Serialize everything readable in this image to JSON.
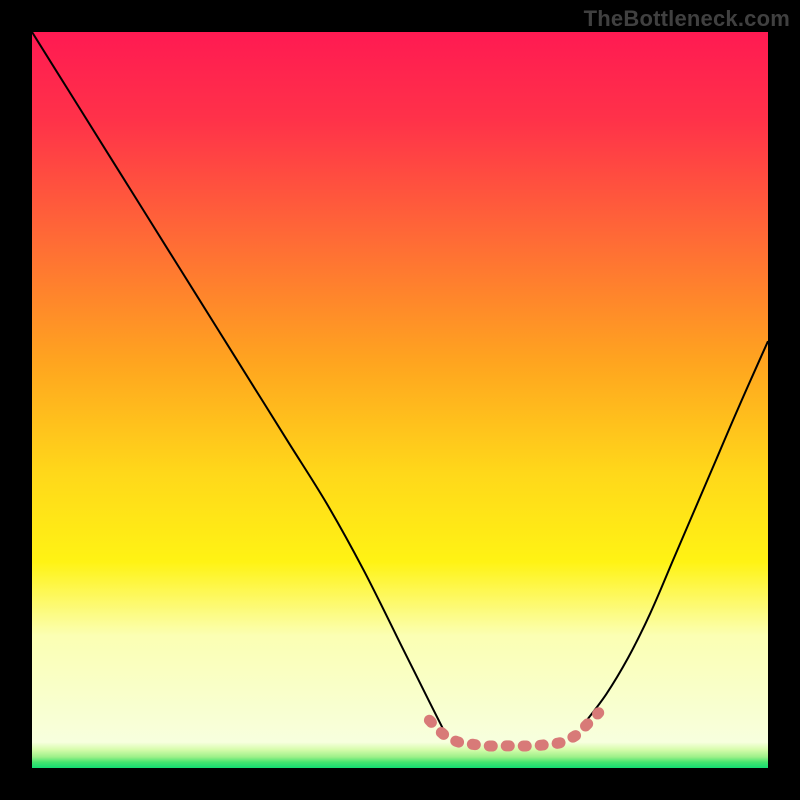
{
  "watermark": "TheBottleneck.com",
  "colors": {
    "frame": "#000000",
    "curve_stroke": "#000000",
    "band_stroke": "#d87a78",
    "gradient_stops": [
      {
        "offset": 0.0,
        "color": "#ff1a52"
      },
      {
        "offset": 0.12,
        "color": "#ff3249"
      },
      {
        "offset": 0.28,
        "color": "#ff6a36"
      },
      {
        "offset": 0.45,
        "color": "#ffa51f"
      },
      {
        "offset": 0.6,
        "color": "#ffd81a"
      },
      {
        "offset": 0.72,
        "color": "#fff314"
      },
      {
        "offset": 0.82,
        "color": "#fbffb3"
      },
      {
        "offset": 0.965,
        "color": "#f7ffde"
      },
      {
        "offset": 0.975,
        "color": "#d6fcab"
      },
      {
        "offset": 0.985,
        "color": "#9cf089"
      },
      {
        "offset": 0.992,
        "color": "#45e46e"
      },
      {
        "offset": 1.0,
        "color": "#14db71"
      }
    ]
  },
  "chart_data": {
    "type": "line",
    "title": "",
    "xlabel": "",
    "ylabel": "",
    "xlim": [
      0,
      100
    ],
    "ylim": [
      0,
      100
    ],
    "grid": false,
    "legend": false,
    "series": [
      {
        "name": "bottleneck_curve_left",
        "x": [
          0,
          5,
          10,
          15,
          20,
          25,
          30,
          35,
          40,
          45,
          50,
          52,
          54,
          56
        ],
        "y": [
          100,
          92,
          84,
          76,
          68,
          60,
          52,
          44,
          36,
          27,
          17,
          13,
          9,
          5
        ]
      },
      {
        "name": "bottleneck_curve_right",
        "x": [
          75,
          78,
          81,
          84,
          87,
          90,
          93,
          96,
          100
        ],
        "y": [
          6,
          10,
          15,
          21,
          28,
          35,
          42,
          49,
          58
        ]
      },
      {
        "name": "optimum_band",
        "x": [
          54,
          56,
          58,
          60,
          62,
          64,
          66,
          68,
          70,
          72,
          74,
          75,
          76,
          77
        ],
        "y": [
          6.5,
          4.5,
          3.5,
          3.2,
          3.0,
          3.0,
          3.0,
          3.0,
          3.2,
          3.5,
          4.5,
          5.5,
          6.5,
          7.5
        ]
      }
    ]
  }
}
